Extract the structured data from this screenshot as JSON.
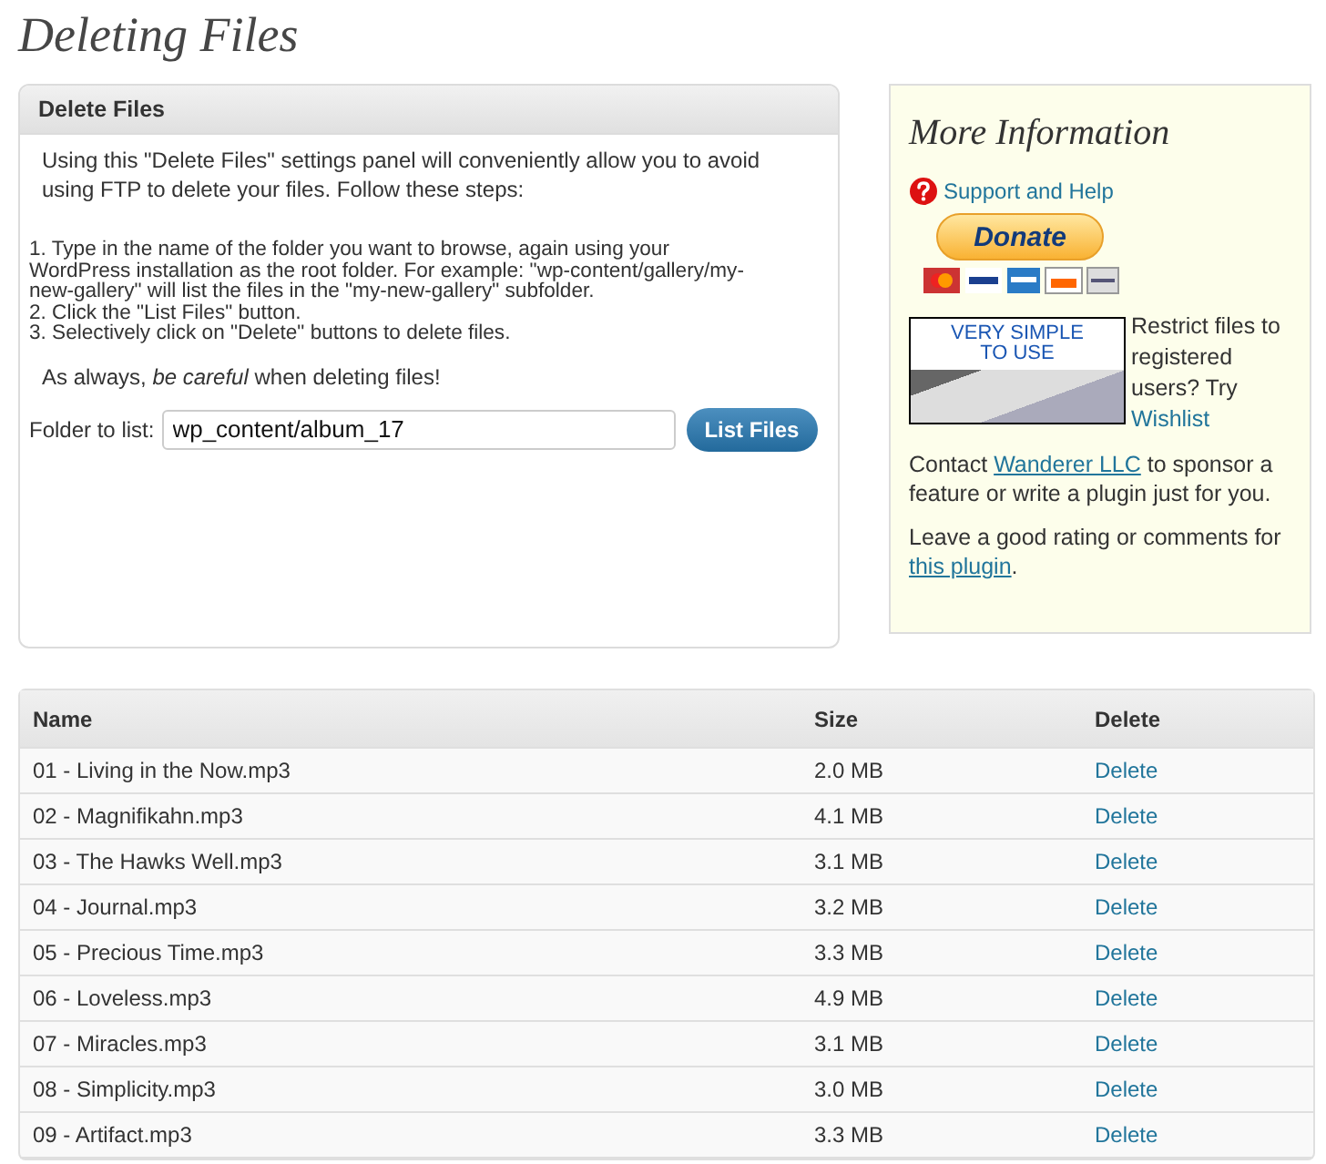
{
  "page_title": "Deleting Files",
  "panel": {
    "title": "Delete Files",
    "intro": "Using this \"Delete Files\" settings panel will conveniently allow you to avoid using FTP to delete your files. Follow these steps:",
    "steps": [
      "1. Type in the name of the folder you want to browse, again using your WordPress installation as the root folder. For example: \"wp-content/gallery/my-new-gallery\" will list the files in the \"my-new-gallery\" subfolder.",
      "2. Click the \"List Files\" button.",
      "3. Selectively click on \"Delete\" buttons to delete files."
    ],
    "caution": "As always, *be careful* when deleting files!",
    "folder_label": "Folder to list:",
    "folder_value": "wp_content/album_17",
    "button": "List Files"
  },
  "info": {
    "title": "More Information",
    "support_link": "Support and Help",
    "donate_button": "Donate",
    "banner_text": "VERY SIMPLE TO USE",
    "restrict_text": "Restrict files to registered users? Try",
    "restrict_link": "Wishlist",
    "contact_before": "Contact",
    "contact_link": "Wanderer LLC",
    "contact_after": "to sponsor a feature or write a plugin just for you.",
    "rating_before": "Leave a good rating or comments for",
    "rating_link": "this plugin",
    "rating_after": "."
  },
  "table": {
    "columns": [
      "Name",
      "Size",
      "Delete"
    ],
    "rows": [
      {
        "name": "01 - Living in the Now.mp3",
        "size": "2.0 MB",
        "action": "Delete"
      },
      {
        "name": "02 - Magnifikahn.mp3",
        "size": "4.1 MB",
        "action": "Delete"
      },
      {
        "name": "03 - The Hawks Well.mp3",
        "size": "3.1 MB",
        "action": "Delete"
      },
      {
        "name": "04 - Journal.mp3",
        "size": "3.2 MB",
        "action": "Delete"
      },
      {
        "name": "05 - Precious Time.mp3",
        "size": "3.3 MB",
        "action": "Delete"
      },
      {
        "name": "06 - Loveless.mp3",
        "size": "4.9 MB",
        "action": "Delete"
      },
      {
        "name": "07 - Miracles.mp3",
        "size": "3.1 MB",
        "action": "Delete"
      },
      {
        "name": "08 - Simplicity.mp3",
        "size": "3.0 MB",
        "action": "Delete"
      },
      {
        "name": "09 - Artifact.mp3",
        "size": "3.3 MB",
        "action": "Delete"
      }
    ]
  }
}
